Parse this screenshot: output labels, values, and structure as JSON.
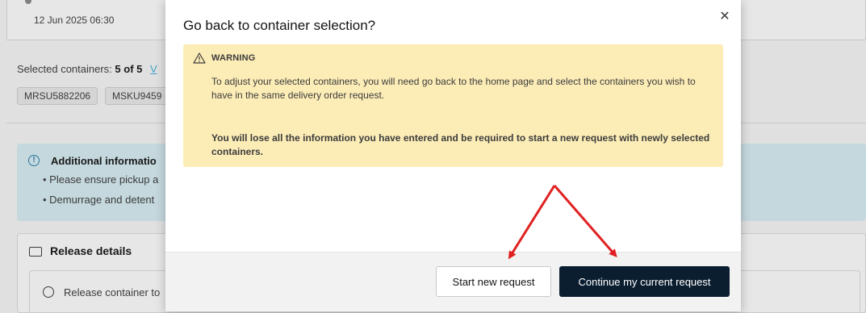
{
  "background": {
    "timestamp": "12 Jun 2025 06:30",
    "selected_label": "Selected containers:",
    "selected_count": "5 of 5",
    "view_link": "V",
    "containers": [
      "MRSU5882206",
      "MSKU9459"
    ],
    "info": {
      "title": "Additional informatio",
      "bullets": [
        "Please ensure pickup a",
        "Demurrage and detent"
      ]
    },
    "release": {
      "title": "Release details",
      "row_label": "Release container to"
    }
  },
  "modal": {
    "title": "Go back to container selection?",
    "close_icon": "close-icon",
    "warning": {
      "icon": "warning-triangle-icon",
      "heading": "WARNING",
      "text": "To adjust your selected containers, you will need go back to the home page and select the containers you wish to have in the same delivery order request.",
      "bold_text": "You will lose all the information you have entered and be required to start a new request with newly selected containers."
    },
    "buttons": {
      "secondary": "Start new request",
      "primary": "Continue my current request"
    }
  },
  "colors": {
    "warning_bg": "#fcecb6",
    "primary_button": "#0b1e30",
    "annotation_arrow": "#e02020",
    "info_bg": "#d8eef5"
  }
}
